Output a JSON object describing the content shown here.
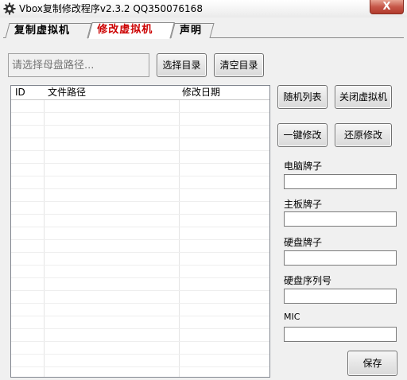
{
  "window": {
    "title": "Vbox复制修改程序v2.3.2  QQ350076168",
    "close_label": "X",
    "icon": "gear-icon"
  },
  "tabs": [
    {
      "label": "复制虚拟机",
      "active": false
    },
    {
      "label": "修改虚拟机",
      "active": true
    },
    {
      "label": "声明",
      "active": false
    }
  ],
  "path": {
    "value": "",
    "placeholder": "请选择母盘路径..."
  },
  "buttons": {
    "select_dir": "选择目录",
    "clear_dir": "清空目录",
    "random_list": "随机列表",
    "close_vm": "关闭虚拟机",
    "one_key_modify": "一键修改",
    "restore_modify": "还原修改",
    "save": "保存"
  },
  "table": {
    "columns": [
      "ID",
      "文件路径",
      "修改日期"
    ],
    "rows": []
  },
  "fields": {
    "pc_brand": {
      "label": "电脑牌子",
      "value": ""
    },
    "board_brand": {
      "label": "主板牌子",
      "value": ""
    },
    "disk_brand": {
      "label": "硬盘牌子",
      "value": ""
    },
    "disk_serial": {
      "label": "硬盘序列号",
      "value": ""
    },
    "mic": {
      "label": "MIC",
      "value": ""
    }
  },
  "colors": {
    "active_tab_text": "#cc0000",
    "close_button": "#c7584a"
  }
}
